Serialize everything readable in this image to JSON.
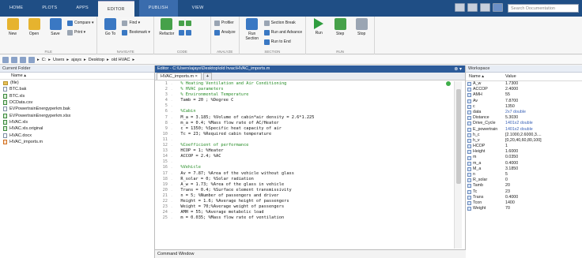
{
  "tabs": [
    "HOME",
    "PLOTS",
    "APPS",
    "EDITOR",
    "PUBLISH",
    "VIEW"
  ],
  "active_tab": "EDITOR",
  "search_placeholder": "Search Documentation",
  "ribbon": {
    "file": {
      "new": "New",
      "open": "Open",
      "save": "Save",
      "compare": "Compare ▾",
      "print": "Print ▾",
      "label": "FILE"
    },
    "navigate": {
      "goto": "Go To",
      "find": "Find ▾",
      "bookmark": "Bookmark ▾",
      "label": "NAVIGATE"
    },
    "edit": {
      "refactor": "Refactor",
      "label": "CODE"
    },
    "analyze": {
      "profiler": "Profiler",
      "analyze": "Analyze",
      "label": "ANALYZE"
    },
    "section": {
      "run_section": "Run Section",
      "section_break": "Section Break",
      "run_and_advance": "Run and Advance",
      "run_to_end": "Run to End",
      "label": "SECTION"
    },
    "run": {
      "run": "Run",
      "step": "Step",
      "stop": "Stop",
      "label": "RUN"
    }
  },
  "path": {
    "items": [
      "C:",
      "Users",
      "ajays",
      "Desktop",
      "old HVAC"
    ]
  },
  "current_folder": {
    "title": "Current Folder",
    "col_name": "Name ▴",
    "files": [
      "(file)",
      "BTC.bak",
      "BTC.xls",
      "DCData.csv",
      "EVPowertrainEnergyperkm.bak",
      "EVPowertrainEnergyperkm.xlsx",
      "HVAC.xls",
      "HVAC.xls.original",
      "HVAC.docx",
      "HVAC_imports.m"
    ]
  },
  "editor": {
    "title": "Editor - C:\\Users\\ajays\\Desktop\\old hvac\\HVAC_imports.m",
    "tab": "HVAC_imports.m",
    "plus": "+",
    "lines": [
      {
        "n": "1",
        "t": "  % Heating Ventilation and Air Conditioning",
        "c": true
      },
      {
        "n": "2",
        "t": "  % HVAC parameters",
        "c": true
      },
      {
        "n": "3",
        "t": "  % Environmental Temperature",
        "c": true
      },
      {
        "n": "4",
        "t": "  Tamb = 20 ; %Degree C",
        "c": false
      },
      {
        "n": "5",
        "t": "",
        "c": false
      },
      {
        "n": "6",
        "t": "  %Cabin",
        "c": true
      },
      {
        "n": "7",
        "t": "  M_a = 3.185; %Volume of cabin*air density = 2.6*1.225",
        "c": false
      },
      {
        "n": "8",
        "t": "  m_a = 0.4; %Mass flow rate of AC/Heater",
        "c": false
      },
      {
        "n": "9",
        "t": "  c = 1350; %Specific heat capacity of air",
        "c": false
      },
      {
        "n": "10",
        "t": "  Tc = 23; %Required cabin temperature",
        "c": false
      },
      {
        "n": "11",
        "t": "",
        "c": false
      },
      {
        "n": "12",
        "t": "  %Coefficient of performance",
        "c": true
      },
      {
        "n": "13",
        "t": "  HCOP = 1; %Heater",
        "c": false
      },
      {
        "n": "14",
        "t": "  ACCOP = 2.4; %AC",
        "c": false
      },
      {
        "n": "15",
        "t": "",
        "c": false
      },
      {
        "n": "16",
        "t": "  %Vehicle",
        "c": true
      },
      {
        "n": "17",
        "t": "  Av = 7.87; %Area of the vehicle without glass",
        "c": false
      },
      {
        "n": "18",
        "t": "  R_solar = 0; %Solar radiation",
        "c": false
      },
      {
        "n": "19",
        "t": "  A_w = 1.73; %Area of the glass in vehicle",
        "c": false
      },
      {
        "n": "20",
        "t": "  Trans = 0.4; %Surface element transmissivity",
        "c": false
      },
      {
        "n": "21",
        "t": "  n = 5; %Number of passengers and driver",
        "c": false
      },
      {
        "n": "22",
        "t": "  Height = 1.6; %Average height of passengers",
        "c": false
      },
      {
        "n": "23",
        "t": "  Weight = 70;%Average weight of passengers",
        "c": false
      },
      {
        "n": "24",
        "t": "  AMH = 55; %Average metabolic load",
        "c": false
      },
      {
        "n": "25",
        "t": "  m = 0.035; %Mass flow rate of ventilation",
        "c": false
      }
    ],
    "command_window": "Command Window"
  },
  "workspace": {
    "title": "Workspace",
    "col_name": "Name ▴",
    "col_value": "Value",
    "vars": [
      {
        "n": "A_w",
        "v": "1.7300",
        "d": false
      },
      {
        "n": "ACCOP",
        "v": "2.4000",
        "d": false
      },
      {
        "n": "AMH",
        "v": "55",
        "d": false
      },
      {
        "n": "Av",
        "v": "7.8700",
        "d": false
      },
      {
        "n": "c",
        "v": "1350",
        "d": false
      },
      {
        "n": "data",
        "v": "2x7 double",
        "d": true
      },
      {
        "n": "Distance",
        "v": "5.3030",
        "d": false
      },
      {
        "n": "Drive_Cycle",
        "v": "1401x2 double",
        "d": true
      },
      {
        "n": "E_powertrain",
        "v": "1401x2 double",
        "d": true
      },
      {
        "n": "h_c",
        "v": "[2.1000,2.6000,3....",
        "d": false
      },
      {
        "n": "h_v",
        "v": "[0,20,40,60,80,100]",
        "d": false
      },
      {
        "n": "HCOP",
        "v": "1",
        "d": false
      },
      {
        "n": "Height",
        "v": "1.6000",
        "d": false
      },
      {
        "n": "m",
        "v": "0.0350",
        "d": false
      },
      {
        "n": "m_a",
        "v": "0.4000",
        "d": false
      },
      {
        "n": "M_a",
        "v": "3.1850",
        "d": false
      },
      {
        "n": "n",
        "v": "5",
        "d": false
      },
      {
        "n": "R_solar",
        "v": "0",
        "d": false
      },
      {
        "n": "Tamb",
        "v": "20",
        "d": false
      },
      {
        "n": "Tc",
        "v": "23",
        "d": false
      },
      {
        "n": "Trans",
        "v": "0.4000",
        "d": false
      },
      {
        "n": "Tcon",
        "v": "1400",
        "d": false
      },
      {
        "n": "Weight",
        "v": "70",
        "d": false
      }
    ]
  }
}
